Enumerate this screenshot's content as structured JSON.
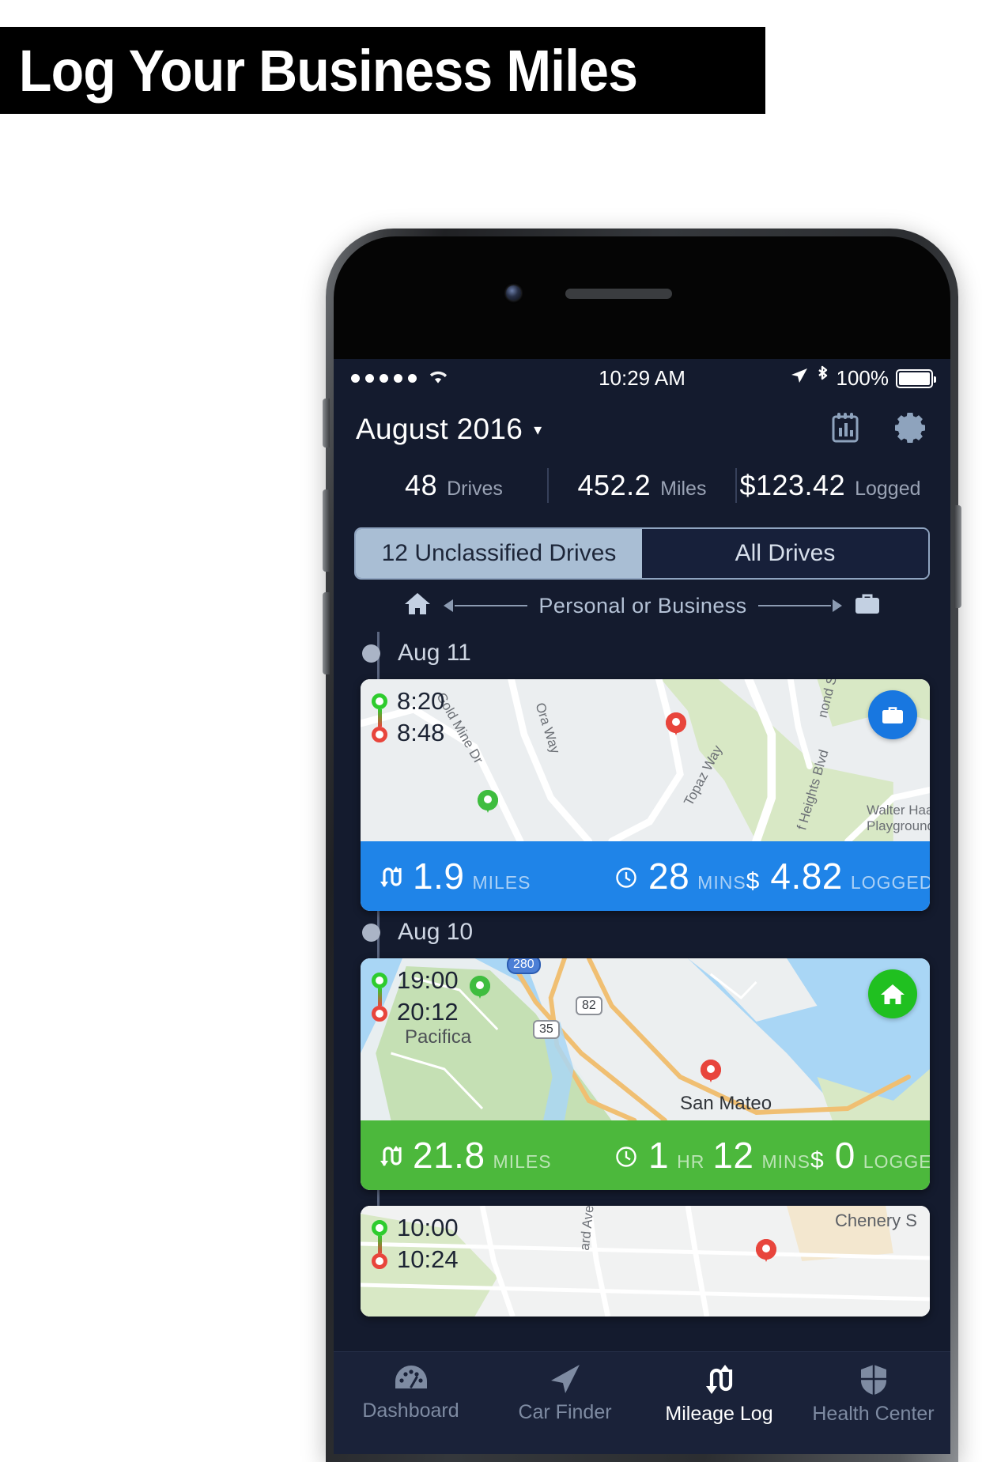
{
  "banner": {
    "text": "Log Your Business Miles"
  },
  "status_bar": {
    "carrier_dots": 5,
    "wifi_icon": "wifi-icon",
    "time": "10:29 AM",
    "location_icon": "location-arrow-icon",
    "bluetooth_icon": "bluetooth-icon",
    "battery_percent": "100%"
  },
  "header": {
    "month": "August 2016",
    "caret": "▾",
    "reports_icon": "reports-chart-icon",
    "settings_icon": "gear-icon"
  },
  "summary": [
    {
      "value": "48",
      "label": "Drives"
    },
    {
      "value": "452.2",
      "label": "Miles"
    },
    {
      "value": "$123.42",
      "label": "Logged"
    }
  ],
  "segmented": {
    "unclassified_label": "12 Unclassified Drives",
    "all_label": "All Drives",
    "active": "unclassified"
  },
  "swipe_hint": {
    "home_icon": "home-icon",
    "left_arrow": "◀",
    "text": "Personal or Business",
    "right_arrow": "▶",
    "briefcase_icon": "briefcase-icon"
  },
  "drives": [
    {
      "day": "Aug 11",
      "start_time": "8:20",
      "end_time": "8:48",
      "badge": "briefcase-icon",
      "badge_type": "business",
      "bar_color": "#1f84e8",
      "distance": "1.9",
      "distance_unit": "MILES",
      "duration_value": "28",
      "duration_unit": "MINS",
      "amount": "4.82",
      "currency": "$",
      "amount_label": "LOGGED",
      "map_labels": [
        "Gold Mine Dr",
        "Ora Way",
        "Topaz Way",
        "f Heights Blvd",
        "nond St",
        "Walter Haa Playground"
      ]
    },
    {
      "day": "Aug 10",
      "start_time": "19:00",
      "end_time": "20:12",
      "badge": "home-icon",
      "badge_type": "personal",
      "bar_color": "#4cb83c",
      "distance": "21.8",
      "distance_unit": "MILES",
      "duration_hours": "1",
      "duration_hours_unit": "HR",
      "duration_value": "12",
      "duration_unit": "MINS",
      "amount": "0",
      "currency": "$",
      "amount_label": "LOGGED",
      "map_labels": [
        "Pacifica",
        "San Mateo"
      ],
      "map_shields": [
        "280",
        "82",
        "35"
      ]
    },
    {
      "day": "",
      "start_time": "10:00",
      "end_time": "10:24",
      "map_labels": [
        "ard Ave",
        "Chenery S"
      ]
    }
  ],
  "tabbar": [
    {
      "label": "Dashboard",
      "icon": "gauge-icon",
      "active": false
    },
    {
      "label": "Car Finder",
      "icon": "navigate-icon",
      "active": false
    },
    {
      "label": "Mileage Log",
      "icon": "road-loop-icon",
      "active": true
    },
    {
      "label": "Health Center",
      "icon": "shield-icon",
      "active": false
    }
  ],
  "colors": {
    "screen_bg": "#141b2e",
    "business_blue": "#1f84e8",
    "personal_green": "#4cb83c",
    "accent_light": "#a9bed4"
  }
}
